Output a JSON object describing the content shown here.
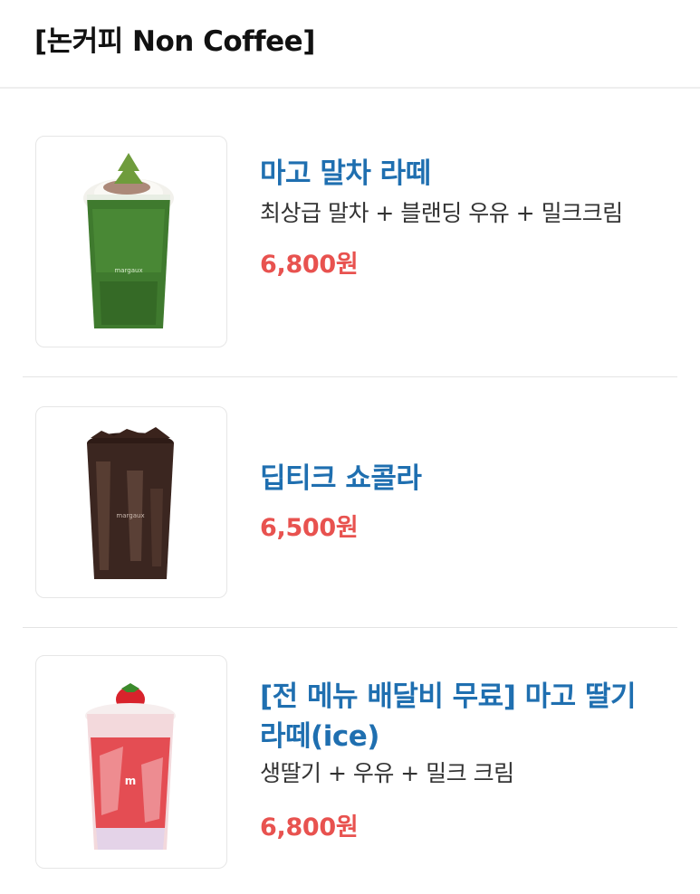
{
  "header": {
    "title": "[논커피 Non Coffee]"
  },
  "items": [
    {
      "name": "마고 말차 라떼",
      "description": "최상급 말차 + 블랜딩 우유 + 밀크크림",
      "price": "6,800원",
      "image_icon": "matcha-latte-drink-image"
    },
    {
      "name": "딥티크 쇼콜라",
      "description": "",
      "price": "6,500원",
      "image_icon": "chocolate-drink-image"
    },
    {
      "name": "[전 메뉴 배달비 무료] 마고 딸기 라떼(ice)",
      "description": "생딸기 + 우유 + 밀크 크림",
      "price": "6,800원",
      "image_icon": "strawberry-latte-drink-image"
    }
  ],
  "colors": {
    "name": "#1f6fb0",
    "price": "#e8524f",
    "matcha": "#3f7a2e",
    "chocolate": "#3b2620",
    "strawberry": "#e0343b"
  }
}
